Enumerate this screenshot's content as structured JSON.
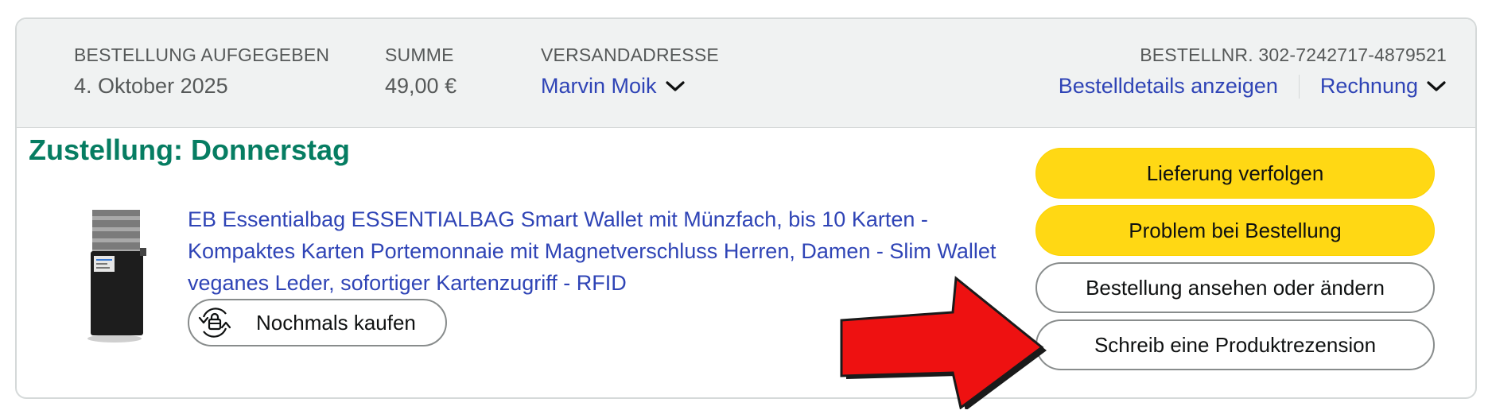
{
  "order_header": {
    "placed_label": "BESTELLUNG AUFGEGEBEN",
    "placed_value": "4. Oktober 2025",
    "total_label": "SUMME",
    "total_value": "49,00 €",
    "ship_label": "VERSANDADRESSE",
    "ship_value": "Marvin Moik",
    "order_number": "BESTELLNR. 302-7242717-4879521",
    "details_link": "Bestelldetails anzeigen",
    "invoice_link": "Rechnung"
  },
  "delivery": {
    "status": "Zustellung: Donnerstag"
  },
  "product": {
    "title": "EB Essentialbag ESSENTIALBAG Smart Wallet mit Münzfach, bis 10 Karten - Kompaktes Karten Portemonnaie mit Magnetverschluss Herren, Damen - Slim Wallet veganes Leder, sofortiger Kartenzugriff - RFID",
    "buy_again_label": "Nochmals kaufen",
    "buy_again_icon": "buy-again-icon"
  },
  "actions": {
    "track": "Lieferung verfolgen",
    "problem": "Problem bei Bestellung",
    "view_edit": "Bestellung ansehen oder ändern",
    "review": "Schreib eine Produktrezension"
  },
  "colors": {
    "delivery_green": "#067d62",
    "link_blue": "#2f44b6",
    "button_yellow": "#ffd814",
    "annotation_arrow": "#ee1111"
  }
}
